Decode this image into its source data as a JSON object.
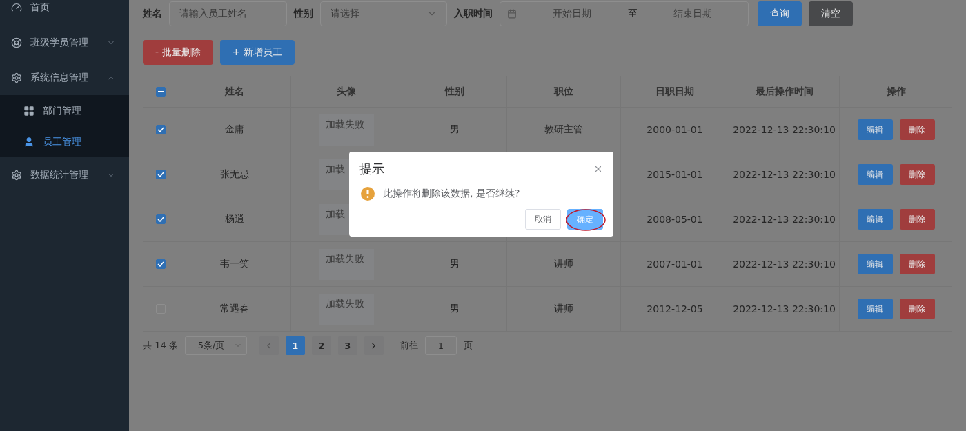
{
  "sidebar": {
    "items": [
      {
        "label": "首页"
      },
      {
        "label": "班级学员管理",
        "expanded": false
      },
      {
        "label": "系统信息管理",
        "expanded": true,
        "children": [
          {
            "label": "部门管理",
            "selected": false
          },
          {
            "label": "员工管理",
            "selected": true
          }
        ]
      },
      {
        "label": "数据统计管理",
        "expanded": false
      }
    ]
  },
  "search": {
    "name_label": "姓名",
    "name_placeholder": "请输入员工姓名",
    "gender_label": "性别",
    "gender_placeholder": "请选择",
    "date_label": "入职时间",
    "date_start": "开始日期",
    "date_sep": "至",
    "date_end": "结束日期",
    "query_button": "查询",
    "clear_button": "清空"
  },
  "actions": {
    "batch_delete": "- 批量删除",
    "add": "+ 新增员工"
  },
  "table": {
    "header_checkbox": {
      "indeterminate": true
    },
    "columns": [
      "姓名",
      "头像",
      "性别",
      "职位",
      "日职日期",
      "最后操作时间",
      "操作"
    ],
    "rows": [
      {
        "checked": true,
        "name": "金庸",
        "avatar": "加载失败",
        "gender": "男",
        "position": "教研主管",
        "date": "2000-01-01",
        "updated": "2022-12-13 22:30:10",
        "edit": "编辑",
        "delete": "删除"
      },
      {
        "checked": true,
        "name": "张无忌",
        "avatar": "加载",
        "date": "2015-01-01",
        "updated": "2022-12-13 22:30:10",
        "edit": "编辑",
        "delete": "删除"
      },
      {
        "checked": true,
        "name": "杨逍",
        "avatar": "加载",
        "date": "2008-05-01",
        "updated": "2022-12-13 22:30:10",
        "edit": "编辑",
        "delete": "删除"
      },
      {
        "checked": true,
        "name": "韦一笑",
        "avatar": "加载失败",
        "gender": "男",
        "position": "讲师",
        "date": "2007-01-01",
        "updated": "2022-12-13 22:30:10",
        "edit": "编辑",
        "delete": "删除"
      },
      {
        "checked": false,
        "name": "常遇春",
        "avatar": "加载失败",
        "gender": "男",
        "position": "讲师",
        "date": "2012-12-05",
        "updated": "2022-12-13 22:30:10",
        "edit": "编辑",
        "delete": "删除"
      }
    ]
  },
  "pagination": {
    "total": "共 14 条",
    "page_size": "5条/页",
    "pages": [
      {
        "label": "1",
        "selected": true
      },
      {
        "label": "2",
        "selected": false
      },
      {
        "label": "3",
        "selected": false
      }
    ],
    "goto_label": "前往",
    "goto_value": "1",
    "goto_suffix": "页"
  },
  "dialog": {
    "title": "提示",
    "message": "此操作将删除该数据, 是否继续?",
    "cancel": "取消",
    "confirm": "确定",
    "confirm_circled": true
  }
}
